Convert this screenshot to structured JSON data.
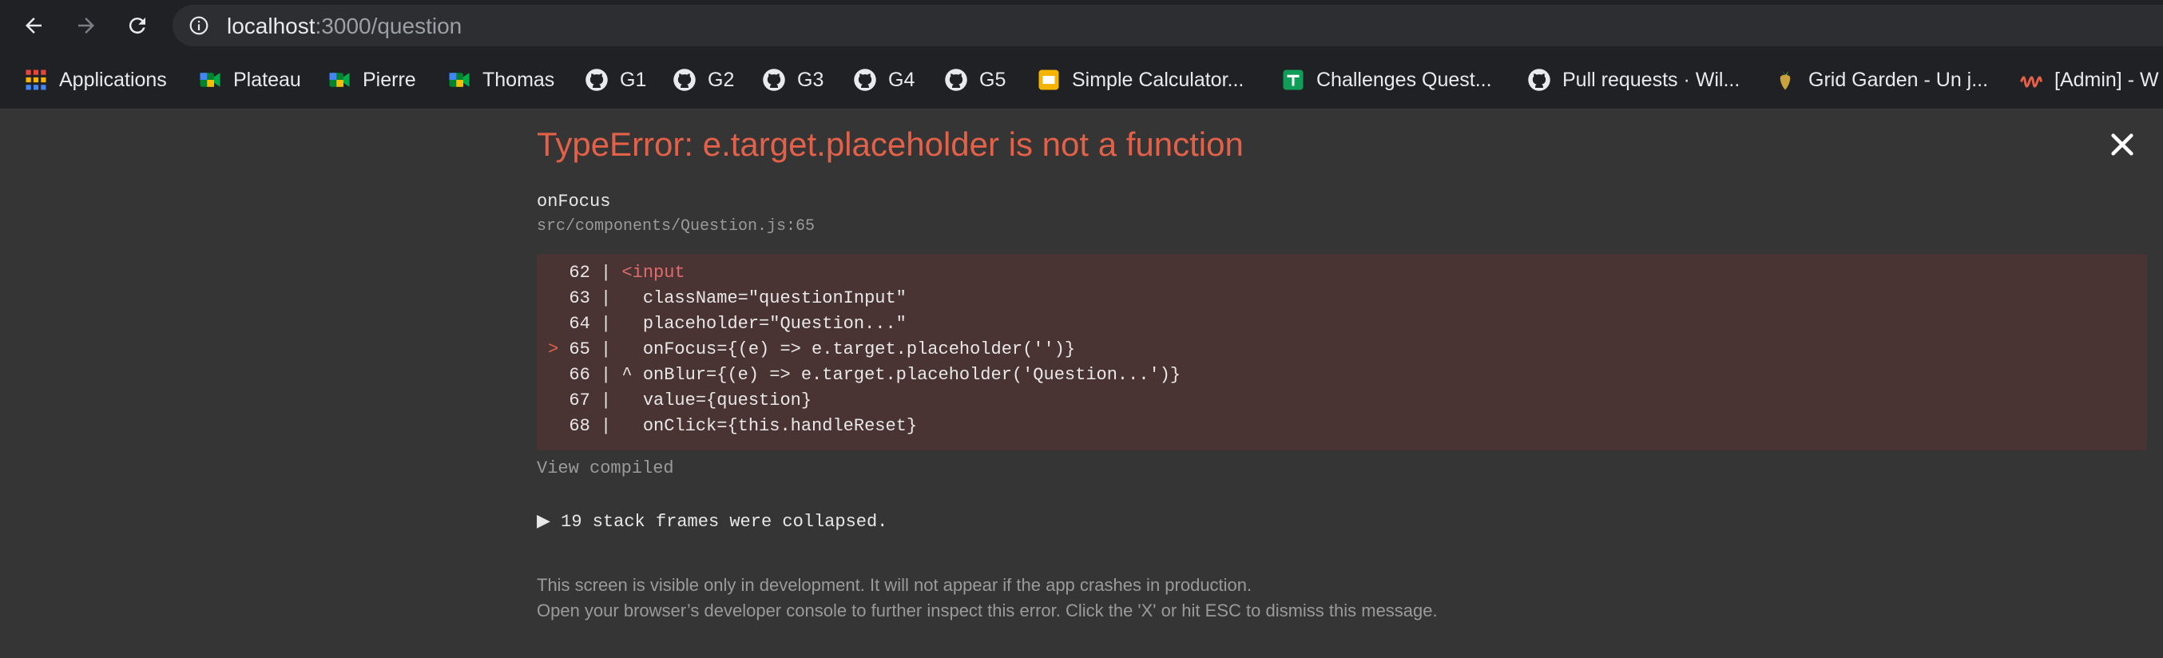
{
  "browser": {
    "url_host": "localhost",
    "url_path": ":3000/question",
    "icons": {
      "back": "back-arrow-icon",
      "forward": "forward-arrow-icon",
      "reload": "reload-icon",
      "info": "info-icon"
    }
  },
  "bookmarks": [
    {
      "label": "Applications",
      "icon": "apps-grid-icon"
    },
    {
      "label": "Plateau",
      "icon": "google-meet-icon"
    },
    {
      "label": "Pierre",
      "icon": "google-meet-icon"
    },
    {
      "label": "Thomas",
      "icon": "google-meet-icon"
    },
    {
      "label": "G1",
      "icon": "github-icon"
    },
    {
      "label": "G2",
      "icon": "github-icon"
    },
    {
      "label": "G3",
      "icon": "github-icon"
    },
    {
      "label": "G4",
      "icon": "github-icon"
    },
    {
      "label": "G5",
      "icon": "github-icon"
    },
    {
      "label": "Simple Calculator...",
      "icon": "slides-icon"
    },
    {
      "label": "Challenges Quest...",
      "icon": "sheets-icon"
    },
    {
      "label": "Pull requests · Wil...",
      "icon": "github-icon"
    },
    {
      "label": "Grid Garden - Un j...",
      "icon": "carrot-icon"
    },
    {
      "label": "[Admin] - W",
      "icon": "wave-icon"
    }
  ],
  "error": {
    "title": "TypeError: e.target.placeholder is not a function",
    "function_name": "onFocus",
    "location": "src/components/Question.js:65",
    "code_lines": [
      {
        "num": "62",
        "marker": " ",
        "sep": "|",
        "text": " <input"
      },
      {
        "num": "63",
        "marker": " ",
        "sep": "|",
        "text": "   className=\"questionInput\""
      },
      {
        "num": "64",
        "marker": " ",
        "sep": "|",
        "text": "   placeholder=\"Question...\""
      },
      {
        "num": "65",
        "marker": ">",
        "sep": "|",
        "text": "   onFocus={(e) => e.target.placeholder('')}"
      },
      {
        "num": "66",
        "marker": " ",
        "sep": "|",
        "text": " ^ onBlur={(e) => e.target.placeholder('Question...')}"
      },
      {
        "num": "67",
        "marker": " ",
        "sep": "|",
        "text": "   value={question}"
      },
      {
        "num": "68",
        "marker": " ",
        "sep": "|",
        "text": "   onClick={this.handleReset}"
      }
    ],
    "view_compiled": "View compiled",
    "stack_frames": "▶ 19 stack frames were collapsed.",
    "footer_line1": "This screen is visible only in development. It will not appear if the app crashes in production.",
    "footer_line2": "Open your browser’s developer console to further inspect this error.  Click the 'X' or hit ESC to dismiss this message.",
    "close_icon": "close-icon"
  },
  "colors": {
    "background": "#353535",
    "error_title": "#e36049",
    "code_background": "#4a3433",
    "chrome": "#202124"
  }
}
